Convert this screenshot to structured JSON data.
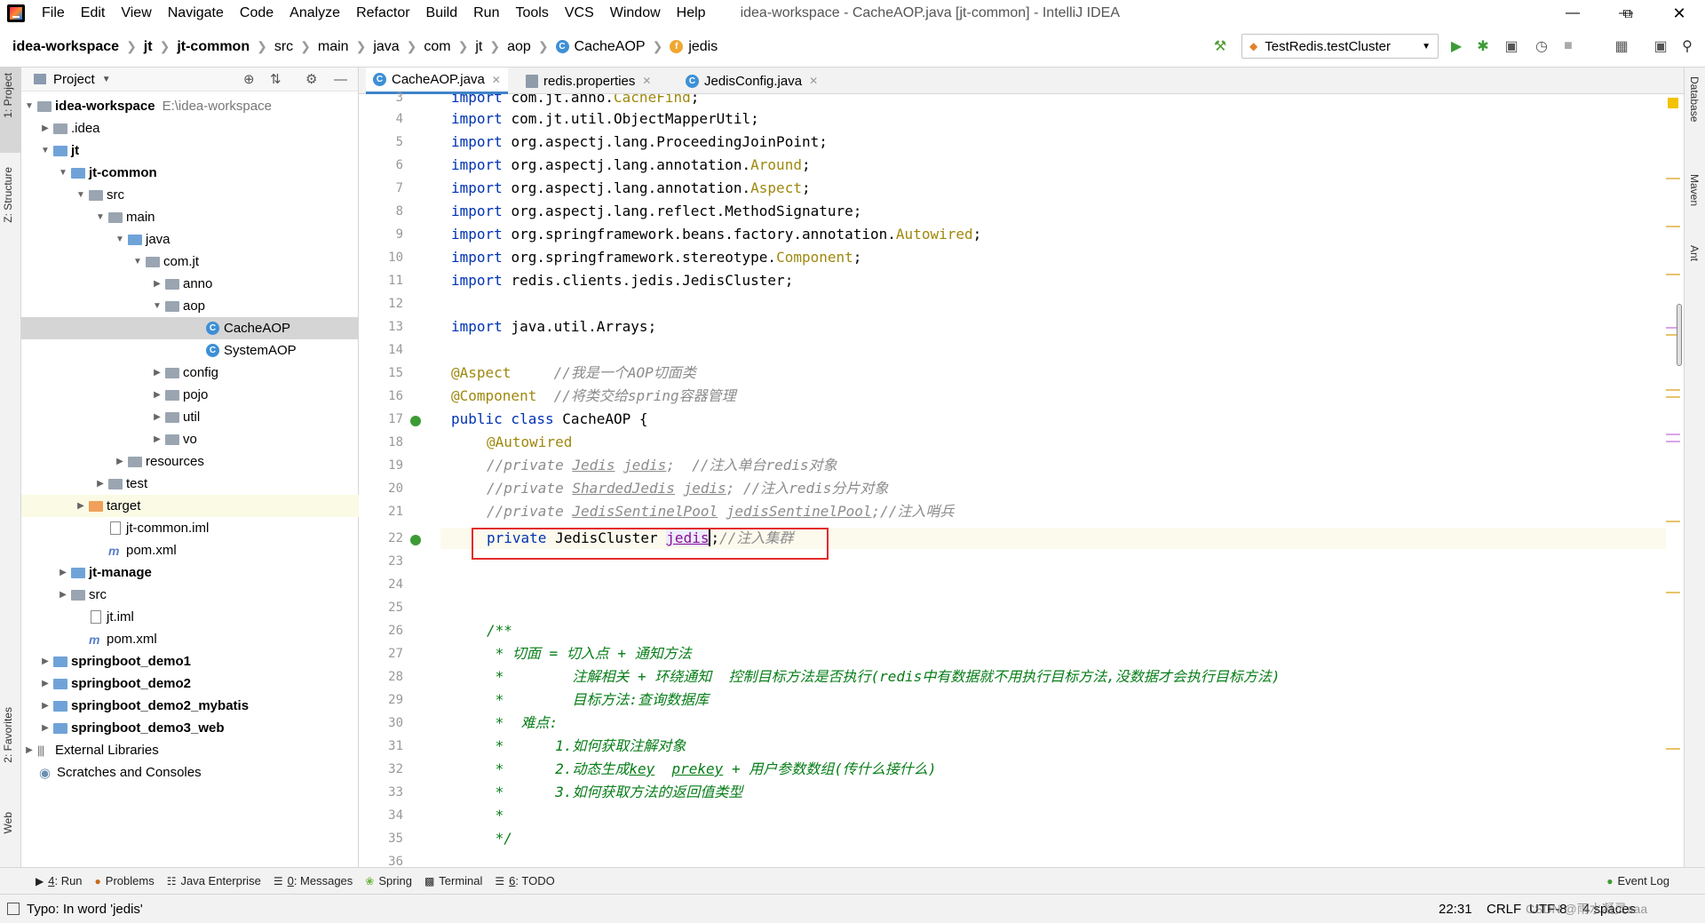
{
  "window": {
    "title": "idea-workspace - CacheAOP.java [jt-common] - IntelliJ IDEA"
  },
  "menu": [
    "File",
    "Edit",
    "View",
    "Navigate",
    "Code",
    "Analyze",
    "Refactor",
    "Build",
    "Run",
    "Tools",
    "VCS",
    "Window",
    "Help"
  ],
  "breadcrumb": [
    "idea-workspace",
    "jt",
    "jt-common",
    "src",
    "main",
    "java",
    "com",
    "jt",
    "aop",
    "CacheAOP",
    "jedis"
  ],
  "run_config": "TestRedis.testCluster",
  "project_panel": {
    "title": "Project"
  },
  "tree": [
    {
      "label": "idea-workspace",
      "path": "E:\\idea-workspace"
    },
    {
      "label": ".idea"
    },
    {
      "label": "jt"
    },
    {
      "label": "jt-common"
    },
    {
      "label": "src"
    },
    {
      "label": "main"
    },
    {
      "label": "java"
    },
    {
      "label": "com.jt"
    },
    {
      "label": "anno"
    },
    {
      "label": "aop"
    },
    {
      "label": "CacheAOP"
    },
    {
      "label": "SystemAOP"
    },
    {
      "label": "config"
    },
    {
      "label": "pojo"
    },
    {
      "label": "util"
    },
    {
      "label": "vo"
    },
    {
      "label": "resources"
    },
    {
      "label": "test"
    },
    {
      "label": "target"
    },
    {
      "label": "jt-common.iml"
    },
    {
      "label": "pom.xml"
    },
    {
      "label": "jt-manage"
    },
    {
      "label": "src"
    },
    {
      "label": "jt.iml"
    },
    {
      "label": "pom.xml"
    },
    {
      "label": "springboot_demo1"
    },
    {
      "label": "springboot_demo2"
    },
    {
      "label": "springboot_demo2_mybatis"
    },
    {
      "label": "springboot_demo3_web"
    },
    {
      "label": "External Libraries"
    },
    {
      "label": "Scratches and Consoles"
    }
  ],
  "tabs": [
    "CacheAOP.java",
    "redis.properties",
    "JedisConfig.java"
  ],
  "left_strip": [
    "1: Project",
    "Z: Structure",
    "2: Favorites",
    "Web"
  ],
  "right_strip": [
    "Database",
    "Maven",
    "Ant"
  ],
  "line_numbers": [
    "3",
    "4",
    "5",
    "6",
    "7",
    "8",
    "9",
    "10",
    "11",
    "12",
    "13",
    "14",
    "15",
    "16",
    "17",
    "18",
    "19",
    "20",
    "21",
    "22",
    "23",
    "24",
    "25",
    "26",
    "27",
    "28",
    "29",
    "30",
    "31",
    "32",
    "33",
    "34",
    "35",
    "36"
  ],
  "code": {
    "l3a": "import ",
    "l3b": "com.jt.anno.",
    "l3c": "CacheFind",
    ";": ";",
    "l4": "com.jt.util.ObjectMapperUtil;",
    "l5": "org.aspectj.lang.ProceedingJoinPoint;",
    "l6a": "org.aspectj.lang.annotation.",
    "l6b": "Around",
    "l7a": "org.aspectj.lang.annotation.",
    "l7b": "Aspect",
    "l8": "org.aspectj.lang.reflect.MethodSignature;",
    "l9a": "org.springframework.beans.factory.annotation.",
    "l9b": "Autowired",
    "l10a": "org.springframework.stereotype.",
    "l10b": "Component",
    "l11": "redis.clients.jedis.JedisCluster;",
    "l13": "java.util.Arrays;",
    "import_kw": "import ",
    "l15a": "@Aspect",
    "l15b": "     //我是一个AOP切面类",
    "l16a": "@Component",
    "l16b": "  //将类交给spring容器管理",
    "l17a": "public class ",
    "l17b": "CacheAOP {",
    "l18": "@Autowired",
    "l19a": "//private ",
    "l19b": "Jedis",
    "l19c": " ",
    "l19d": "jedis",
    "l19e": ";  //注入单台redis对象",
    "l20a": "//private ",
    "l20b": "ShardedJedis",
    "l20c": " ",
    "l20d": "jedis",
    "l20e": "; //注入redis分片对象",
    "l21a": "//private ",
    "l21b": "JedisSentinelPool",
    "l21c": " ",
    "l21d": "jedisSentinelPool",
    "l21e": ";//注入哨兵",
    "l22a": "private ",
    "l22b": "JedisCluster ",
    "l22c": "jedis",
    "l22d": ";",
    "l22e": "//注入集群",
    "l26": "/**",
    "l27": " * 切面 = 切入点 + 通知方法",
    "l28": " *        注解相关 + 环绕通知  控制目标方法是否执行(redis中有数据就不用执行目标方法,没数据才会执行目标方法)",
    "l29": " *        目标方法:查询数据库",
    "l30": " *  难点:",
    "l31": " *      1.如何获取注解对象",
    "l32a": " *      2.动态生成",
    "l32b": "key",
    "l32c": "  ",
    "l32d": "prekey",
    "l32e": " + 用户参数数组(传什么接什么)",
    "l33": " *      3.如何获取方法的返回值类型",
    "l34": " *",
    "l35": " */"
  },
  "bottom_tools": [
    {
      "num": "4",
      "label": ": Run"
    },
    {
      "label": "Problems"
    },
    {
      "label": "Java Enterprise"
    },
    {
      "num": "0",
      "label": ": Messages"
    },
    {
      "label": "Spring"
    },
    {
      "label": "Terminal"
    },
    {
      "num": "6",
      "label": ": TODO"
    }
  ],
  "event_log": "Event Log",
  "status": {
    "message": "Typo: In word 'jedis'",
    "position": "22:31",
    "line_sep": "CRLF",
    "encoding": "UTF-8",
    "indent": "4 spaces",
    "watermark": "CSDN @雨水凝灵aaa"
  },
  "colors": {
    "keyword": "#0033b3",
    "annotation": "#9e880d",
    "comment": "#8c8c8c",
    "doc": "#067d17",
    "highlight_box": "#e32b2b"
  }
}
